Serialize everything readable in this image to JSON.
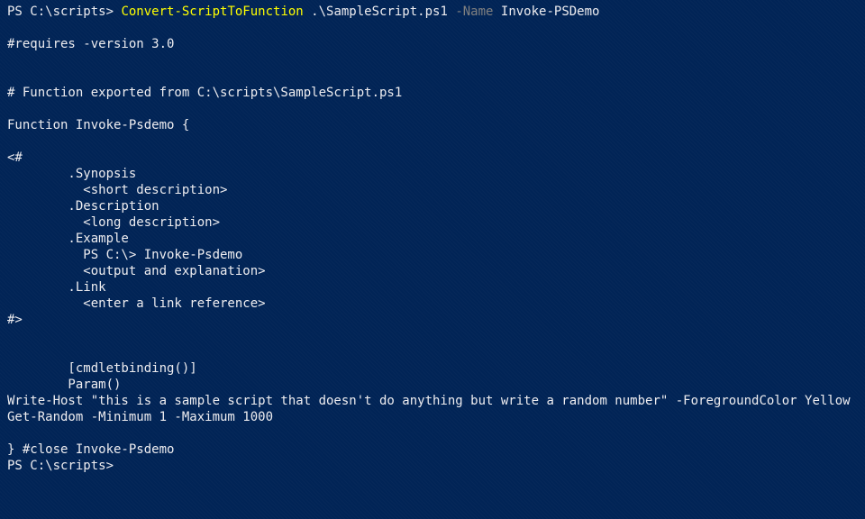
{
  "console": {
    "prompt1_prefix": "PS C:\\scripts> ",
    "prompt1_cmdlet": "Convert-ScriptToFunction",
    "prompt1_arg_path": " .\\SampleScript.ps1",
    "prompt1_param": " -Name",
    "prompt1_arg_name": " Invoke-PSDemo",
    "blank": "",
    "output": {
      "l01": "#requires -version 3.0",
      "l02": "",
      "l03": "",
      "l04": "# Function exported from C:\\scripts\\SampleScript.ps1",
      "l05": "",
      "l06": "Function Invoke-Psdemo {",
      "l07": "",
      "l08": "<#",
      "l09": "        .Synopsis",
      "l10": "          <short description>",
      "l11": "        .Description",
      "l12": "          <long description>",
      "l13": "        .Example",
      "l14": "          PS C:\\> Invoke-Psdemo",
      "l15": "          <output and explanation>",
      "l16": "        .Link",
      "l17": "          <enter a link reference>",
      "l18": "#>",
      "l19": "",
      "l20": "",
      "l21": "        [cmdletbinding()]",
      "l22": "        Param()",
      "l23": "Write-Host \"this is a sample script that doesn't do anything but write a random number\" -ForegroundColor Yellow",
      "l24": "Get-Random -Minimum 1 -Maximum 1000",
      "l25": "",
      "l26": "} #close Invoke-Psdemo"
    },
    "prompt2": "PS C:\\scripts>"
  }
}
